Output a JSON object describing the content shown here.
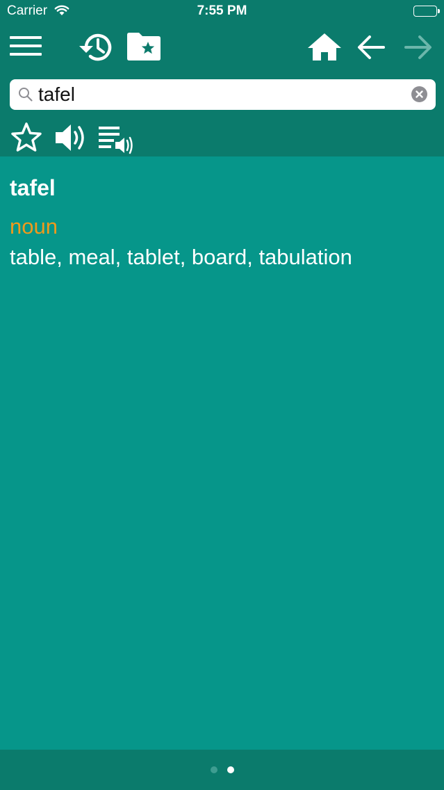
{
  "status_bar": {
    "carrier": "Carrier",
    "time": "7:55 PM"
  },
  "toolbar": {
    "icons": [
      "menu-icon",
      "history-icon",
      "favorites-folder-icon",
      "home-icon",
      "back-arrow-icon",
      "forward-arrow-icon"
    ],
    "forward_enabled": false
  },
  "search": {
    "value": "tafel",
    "placeholder": ""
  },
  "actions": {
    "icons": [
      "star-icon",
      "speaker-icon",
      "speak-list-icon"
    ]
  },
  "entry": {
    "headword": "tafel",
    "part_of_speech": "noun",
    "translations": "table, meal, tablet, board, tabulation"
  },
  "pager": {
    "pages": 2,
    "current": 2
  },
  "colors": {
    "background": "#06968a",
    "bars": "#0b7b6c",
    "part_of_speech": "#f09a1c",
    "text": "#ffffff"
  }
}
